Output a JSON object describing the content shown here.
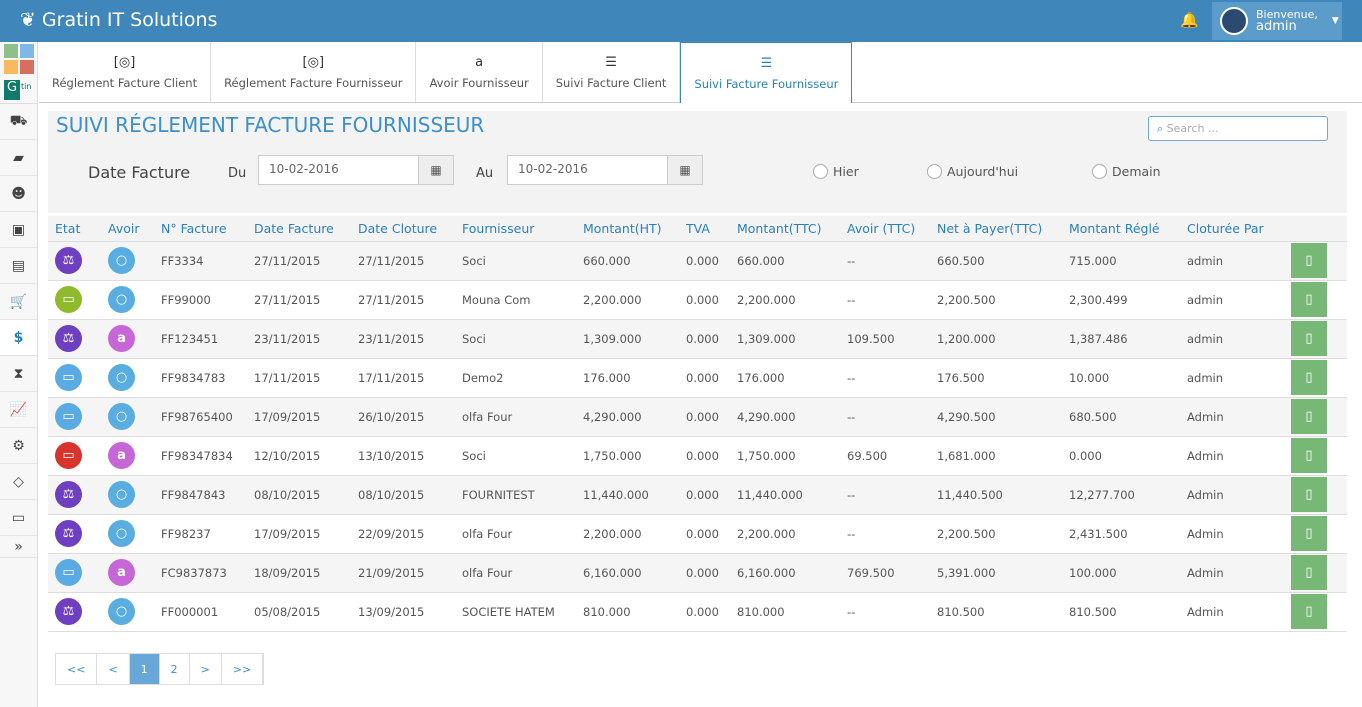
{
  "app": {
    "title": "Gratin IT Solutions",
    "welcome": "Bienvenue,",
    "user": "admin"
  },
  "sidebar": [
    "truck",
    "book",
    "users",
    "briefcase",
    "suitcase",
    "cart",
    "dollar",
    "hourglass",
    "chart",
    "gears",
    "diamond",
    "money",
    "expand"
  ],
  "tabs": [
    {
      "label": "Réglement Facture Client",
      "icon": "money-icon"
    },
    {
      "label": "Réglement Facture Fournisseur",
      "icon": "money-icon"
    },
    {
      "label": "Avoir Fournisseur",
      "icon": "amazon-icon"
    },
    {
      "label": "Suivi Facture Client",
      "icon": "list-icon"
    },
    {
      "label": "Suivi Facture Fournisseur",
      "icon": "list-icon",
      "active": true
    }
  ],
  "page": {
    "title": "SUIVI RÉGLEMENT FACTURE FOURNISSEUR",
    "search_placeholder": "Search ...",
    "date_label": "Date Facture",
    "du": "Du",
    "au": "Au",
    "du_value": "10-02-2016",
    "au_value": "10-02-2016",
    "radios": [
      "Hier",
      "Aujourd'hui",
      "Demain"
    ]
  },
  "table": {
    "headers": [
      "Etat",
      "Avoir",
      "N° Facture",
      "Date Facture",
      "Date Cloture",
      "Fournisseur",
      "Montant(HT)",
      "TVA",
      "Montant(TTC)",
      "Avoir (TTC)",
      "Net à Payer(TTC)",
      "Montant Réglé",
      "Cloturée Par"
    ],
    "rows": [
      {
        "etat": "scale",
        "avoir": "circle",
        "c": [
          "FF3334",
          "27/11/2015",
          "27/11/2015",
          "Soci",
          "660.000",
          "0.000",
          "660.000",
          "--",
          "660.500",
          "715.000",
          "admin"
        ]
      },
      {
        "etat": "battery-full",
        "avoir": "circle",
        "c": [
          "FF99000",
          "27/11/2015",
          "27/11/2015",
          "Mouna Com",
          "2,200.000",
          "0.000",
          "2,200.000",
          "--",
          "2,200.500",
          "2,300.499",
          "admin"
        ]
      },
      {
        "etat": "scale",
        "avoir": "amazon",
        "c": [
          "FF123451",
          "23/11/2015",
          "23/11/2015",
          "Soci",
          "1,309.000",
          "0.000",
          "1,309.000",
          "109.500",
          "1,200.000",
          "1,387.486",
          "admin"
        ]
      },
      {
        "etat": "battery-half",
        "avoir": "circle",
        "c": [
          "FF9834783",
          "17/11/2015",
          "17/11/2015",
          "Demo2",
          "176.000",
          "0.000",
          "176.000",
          "--",
          "176.500",
          "10.000",
          "admin"
        ]
      },
      {
        "etat": "battery-half",
        "avoir": "circle",
        "c": [
          "FF98765400",
          "17/09/2015",
          "26/10/2015",
          "olfa Four",
          "4,290.000",
          "0.000",
          "4,290.000",
          "--",
          "4,290.500",
          "680.500",
          "Admin"
        ]
      },
      {
        "etat": "battery-empty",
        "avoir": "amazon",
        "c": [
          "FF98347834",
          "12/10/2015",
          "13/10/2015",
          "Soci",
          "1,750.000",
          "0.000",
          "1,750.000",
          "69.500",
          "1,681.000",
          "0.000",
          "Admin"
        ]
      },
      {
        "etat": "scale",
        "avoir": "circle",
        "c": [
          "FF9847843",
          "08/10/2015",
          "08/10/2015",
          "FOURNITEST",
          "11,440.000",
          "0.000",
          "11,440.000",
          "--",
          "11,440.500",
          "12,277.700",
          "Admin"
        ]
      },
      {
        "etat": "scale",
        "avoir": "circle",
        "c": [
          "FF98237",
          "17/09/2015",
          "22/09/2015",
          "olfa Four",
          "2,200.000",
          "0.000",
          "2,200.000",
          "--",
          "2,200.500",
          "2,431.500",
          "Admin"
        ]
      },
      {
        "etat": "battery-half",
        "avoir": "amazon",
        "c": [
          "FC9837873",
          "18/09/2015",
          "21/09/2015",
          "olfa Four",
          "6,160.000",
          "0.000",
          "6,160.000",
          "769.500",
          "5,391.000",
          "100.000",
          "Admin"
        ]
      },
      {
        "etat": "scale",
        "avoir": "circle",
        "c": [
          "FF000001",
          "05/08/2015",
          "13/09/2015",
          "SOCIETE HATEM",
          "810.000",
          "0.000",
          "810.000",
          "--",
          "810.500",
          "810.500",
          "Admin"
        ]
      }
    ]
  },
  "pagination": [
    "<<",
    "<",
    "1",
    "2",
    ">",
    ">>"
  ],
  "colors": {
    "scale": "#6f3fc1",
    "battery-full": "#8fba2c",
    "battery-half": "#5aabe3",
    "battery-empty": "#d9342b",
    "circle": "#5aade0",
    "amazon": "#c766d6"
  }
}
